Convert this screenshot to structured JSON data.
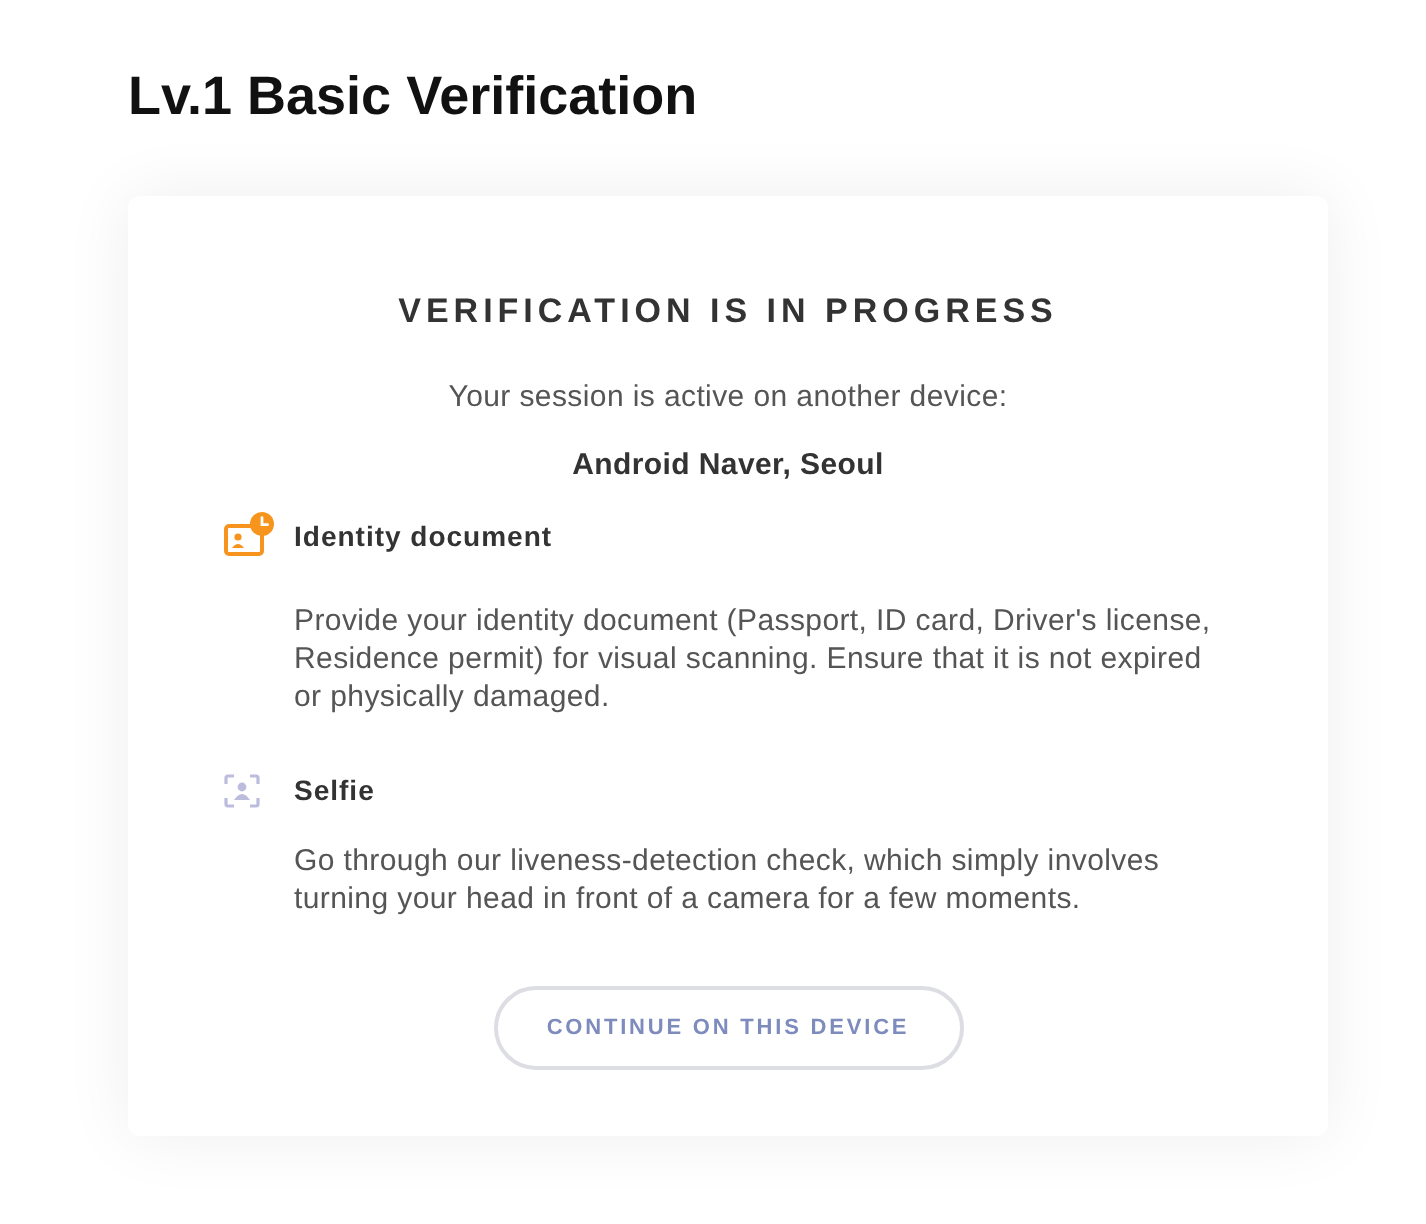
{
  "page": {
    "title": "Lv.1 Basic Verification"
  },
  "card": {
    "title": "VERIFICATION IS IN PROGRESS",
    "subtitle": "Your session is active on another device:",
    "device": "Android Naver, Seoul",
    "steps": [
      {
        "kind": "document",
        "in_progress": true,
        "title": "Identity document",
        "description": "Provide your identity document (Passport, ID card, Driver's license, Residence permit) for visual scanning. Ensure that it is not expired or physically damaged."
      },
      {
        "kind": "selfie",
        "in_progress": false,
        "title": "Selfie",
        "description": "Go through our liveness-detection check, which simply involves turning your head in front of a camera for a few moments."
      }
    ],
    "button": {
      "label": "CONTINUE ON THIS DEVICE"
    }
  }
}
